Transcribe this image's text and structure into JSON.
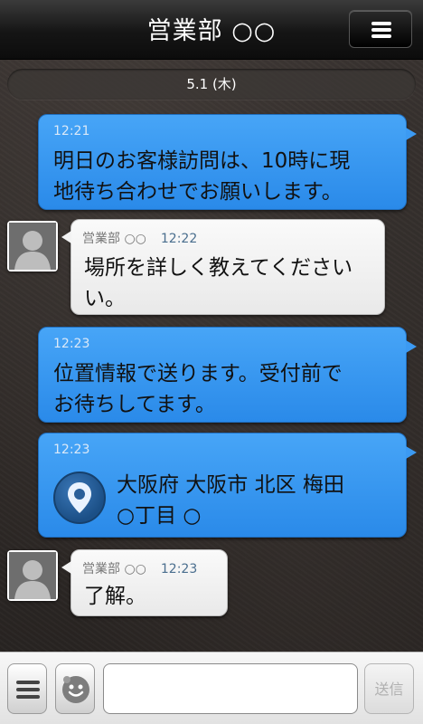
{
  "header": {
    "title": "営業部 ○○"
  },
  "date_label": "5.1 (木)",
  "messages": [
    {
      "sender": "me",
      "time": "12:21",
      "line1": "明日のお客様訪問は、10時に現",
      "line2": "地待ち合わせでお願いします。"
    },
    {
      "sender": "営業部 ○○",
      "time": "12:22",
      "line1": "場所を詳しく教えてください",
      "line2": "い。"
    },
    {
      "sender": "me",
      "time": "12:23",
      "line1": "位置情報で送ります。受付前で",
      "line2": "お待ちしてます。"
    },
    {
      "sender": "me",
      "time": "12:23",
      "location_line1": "大阪府 大阪市 北区 梅田",
      "location_line2": "○丁目 ○"
    },
    {
      "sender": "営業部 ○○",
      "time": "12:23",
      "line1": "了解。"
    }
  ],
  "composer": {
    "value": "",
    "send_label": "送信"
  },
  "icons": {
    "menu": "hamburger-menu-icon",
    "avatar": "person-silhouette-icon",
    "location": "location-pin-icon",
    "attach": "menu-lines-icon",
    "sticker": "sticker-face-icon"
  },
  "colors": {
    "my_bubble": "#3a9af2",
    "their_bubble": "#f2f2f2",
    "header": "#111111"
  }
}
